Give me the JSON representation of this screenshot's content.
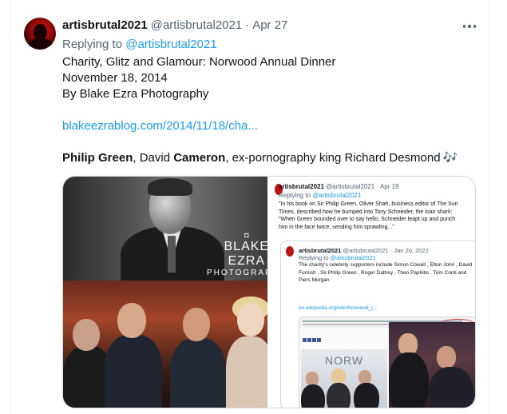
{
  "tweet": {
    "display_name": "artisbrutal2021",
    "handle": "@artisbrutal2021",
    "separator": "·",
    "date": "Apr 27",
    "replying_prefix": "Replying to",
    "replying_to": "@artisbrutal2021",
    "lines": [
      "Charity, Glitz and Glamour: Norwood Annual Dinner",
      "November 18, 2014",
      "By Blake Ezra Photography"
    ],
    "link": "blakeezrablog.com/2014/11/18/cha...",
    "people": {
      "p1_bold": "Philip Green",
      "p2_plain": ", David ",
      "p3_bold": "Cameron",
      "p4_plain": ", ex-pornography king Richard Desmond",
      "emoji": "🎶"
    }
  },
  "media": {
    "watermark_line1": "BLAKE EZRA",
    "watermark_line2": "PHOTOGRAPHY",
    "screenshot": {
      "name": "artisbrutal2021",
      "handle": "@artisbrutal2021",
      "date": "Apr 19",
      "replying_prefix": "Replying to",
      "replying_to": "@artisbrutal2021",
      "text": [
        "\"In his book on Sir Philip Green, Oliver Shah, business editor of The Sun",
        "Times, described how he bumped into Tony Schneider, the loan shark:",
        "\"When  Green bounded over to say hello, Schneider leapt up and punch",
        "him in  the face twice, sending him sprawling. .\""
      ],
      "quote": {
        "name": "artisbrutal2021",
        "handle": "@artisbrutal2021",
        "date": "Jan 20, 2022",
        "replying_prefix": "Replying to",
        "replying_to": "@artisbrutal2021",
        "text": [
          "The charity's celebrity supporters include Simon Cowell , Elton John , David",
          "Furnish , Sir Philip Green , Roger Daltrey , Theo Paphitis , Tom Conti and",
          "Piers Morgan"
        ],
        "link": "en.wikipedia.org/wiki/Norwood_(...",
        "card_word": "NORW"
      }
    }
  },
  "colors": {
    "link": "#1d9bf0",
    "secondary": "#536471",
    "text": "#0f1419",
    "border": "#cfd9de"
  }
}
